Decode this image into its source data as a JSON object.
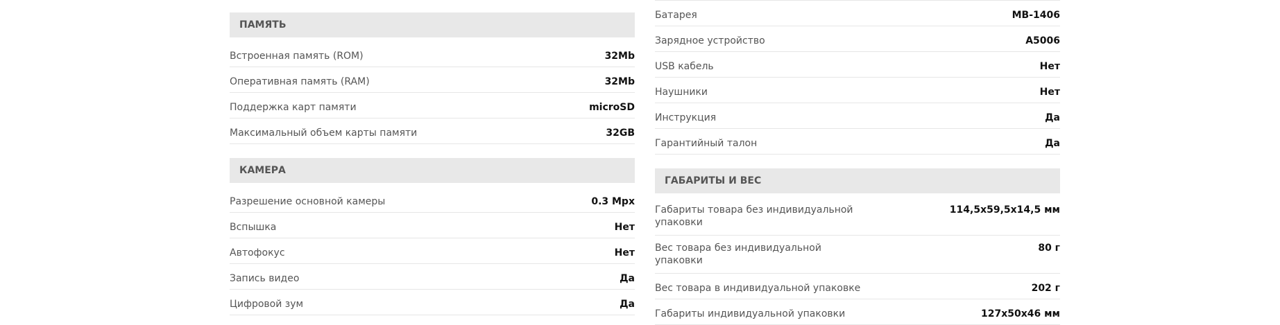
{
  "left": {
    "memory": {
      "title": "ПАМЯТЬ",
      "rows": [
        {
          "label": "Встроенная память (ROM)",
          "value": "32Mb"
        },
        {
          "label": "Оперативная память (RAM)",
          "value": "32Mb"
        },
        {
          "label": "Поддержка карт памяти",
          "value": "microSD"
        },
        {
          "label": "Максимальный объем карты памяти",
          "value": "32GB"
        }
      ]
    },
    "camera": {
      "title": "КАМЕРА",
      "rows": [
        {
          "label": "Разрешение основной камеры",
          "value": "0.3 Mpx"
        },
        {
          "label": "Вспышка",
          "value": "Нет"
        },
        {
          "label": "Автофокус",
          "value": "Нет"
        },
        {
          "label": "Запись видео",
          "value": "Да"
        },
        {
          "label": "Цифровой зум",
          "value": "Да"
        }
      ]
    }
  },
  "right": {
    "package": {
      "rows": [
        {
          "label": "Батарея",
          "value": "MB-1406"
        },
        {
          "label": "Зарядное устройство",
          "value": "A5006"
        },
        {
          "label": "USB кабель",
          "value": "Нет"
        },
        {
          "label": "Наушники",
          "value": "Нет"
        },
        {
          "label": "Инструкция",
          "value": "Да"
        },
        {
          "label": "Гарантийный талон",
          "value": "Да"
        }
      ]
    },
    "dimensions": {
      "title": "ГАБАРИТЫ И ВЕС",
      "rows": [
        {
          "label": "Габариты товара без индивидуальной упаковки",
          "value": "114,5x59,5x14,5 мм"
        },
        {
          "label": "Вес товара без индивидуальной упаковки",
          "value": "80 г"
        },
        {
          "label": "Вес товара в индивидуальной упаковке",
          "value": "202 г"
        },
        {
          "label": "Габариты индивидуальной упаковки",
          "value": "127x50x46 мм"
        }
      ]
    }
  }
}
